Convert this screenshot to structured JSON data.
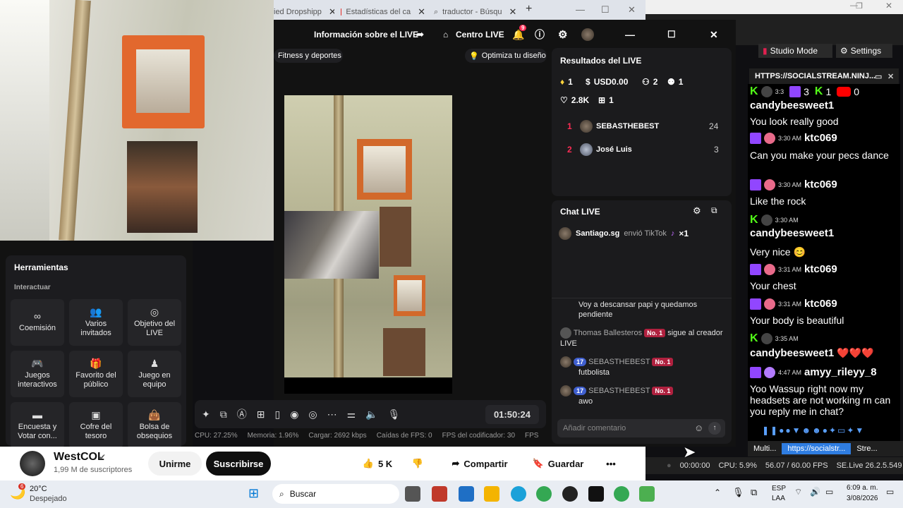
{
  "browser": {
    "tabs": [
      {
        "label": "ied Dropshipp"
      },
      {
        "label": "Estadísticas del ca"
      },
      {
        "label": "traductor - Búsqu"
      }
    ],
    "new_tab": "+",
    "min": "—",
    "max": "☐",
    "close": "✕"
  },
  "tiktok_header": {
    "info_label": "Información sobre el LIVE",
    "center_label": "Centro LIVE",
    "notif_count": "9"
  },
  "category": {
    "label": "Fitness y deportes",
    "optimize": "Optimiza tu diseño"
  },
  "tools": {
    "title": "Herramientas",
    "section": "Interactuar",
    "items": [
      {
        "label": "Coemisión"
      },
      {
        "label": "Varios invitados"
      },
      {
        "label": "Objetivo del LIVE"
      },
      {
        "label": "Juegos interactivos"
      },
      {
        "label": "Favorito del público"
      },
      {
        "label": "Juego en equipo"
      },
      {
        "label": "Encuesta y Votar con..."
      },
      {
        "label": "Cofre del tesoro"
      },
      {
        "label": "Bolsa de obsequios"
      }
    ]
  },
  "controls": {
    "timer": "01:50:24"
  },
  "stats": {
    "cpu": "CPU: 27.25%",
    "memory": "Memoria: 1.96%",
    "upload": "Cargar: 2692 kbps",
    "fps_drops": "Caídas de FPS: 0",
    "encoder_fps": "FPS del codificador: 30",
    "fps": "FPS"
  },
  "results": {
    "title": "Resultados del LIVE",
    "diamonds": "1",
    "usd": "USD0.00",
    "viewers": "2",
    "new_followers": "1",
    "likes": "2.8K",
    "gifts": "1",
    "ranking": [
      {
        "rank": "1",
        "name": "SEBASTHEBEST",
        "score": "24"
      },
      {
        "rank": "2",
        "name": "José Luis",
        "score": "3"
      }
    ]
  },
  "chat": {
    "title": "Chat LIVE",
    "gift_user": "Santiago.sg",
    "gift_text": "envió TikTok",
    "gift_count": "×1",
    "messages": [
      {
        "text": "Voy a descansar papi y quedamos pendiente"
      },
      {
        "user": "Thomas Ballesteros",
        "badge": "No. 1",
        "text": "sigue al creador LIVE"
      },
      {
        "user": "SEBASTHEBEST",
        "level": "17",
        "badge": "No. 1",
        "text": "futbolista"
      },
      {
        "user": "SEBASTHEBEST",
        "level": "17",
        "badge": "No. 1",
        "text": "awo"
      }
    ],
    "placeholder": "Añadir comentario"
  },
  "socialstream": {
    "studio_mode": "Studio Mode",
    "settings": "Settings",
    "url_title": "HTTPS://SOCIALSTREAM.NINJ...",
    "counts": {
      "twitch": "3",
      "kick": "1",
      "youtube": "0"
    },
    "entries": [
      {
        "time": "3:3",
        "name": "candybeesweet1",
        "text": "You look really good"
      },
      {
        "time": "3:30 AM",
        "name": "ktc069",
        "text": "Can you make your pecs dance"
      },
      {
        "time": "3:30 AM",
        "name": "ktc069",
        "text": "Like the rock"
      },
      {
        "time": "3:30 AM",
        "name": "candybeesweet1",
        "text": "Very nice 😊"
      },
      {
        "time": "3:31 AM",
        "name": "ktc069",
        "text": "Your chest"
      },
      {
        "time": "3:31 AM",
        "name": "ktc069",
        "text": "Your body is beautiful"
      },
      {
        "time": "3:35 AM",
        "name": "candybeesweet1",
        "text": "❤️❤️❤️"
      },
      {
        "time": "4:47 AM",
        "name": "amyy_rileyy_8",
        "text": "Yoo Wassup right now my headsets are not working rn can you reply me in chat?"
      }
    ],
    "bottom_tabs": [
      "Multi...",
      "https://socialstr...",
      "Stre..."
    ],
    "status": {
      "time": "00:00:00",
      "cpu": "CPU: 5.9%",
      "fps": "56.07 / 60.00 FPS",
      "version": "SE.Live 26.2.5.549"
    }
  },
  "youtube": {
    "channel": "WestCOL",
    "subs": "1,99 M de suscriptores",
    "join": "Unirme",
    "subscribe": "Suscribirse",
    "likes": "5 K",
    "share": "Compartir",
    "save": "Guardar",
    "more": "•••"
  },
  "taskbar": {
    "temp": "20°C",
    "weather": "Despejado",
    "weather_badge": "6",
    "search": "Buscar",
    "lang1": "ESP",
    "lang2": "LAA",
    "time": "6:09 a. m.",
    "date": "3/08/2026"
  },
  "colors": {
    "tiktok_red": "#fe2c55",
    "twitch": "#9146ff",
    "kick": "#53fc18",
    "youtube": "#ff0000"
  }
}
